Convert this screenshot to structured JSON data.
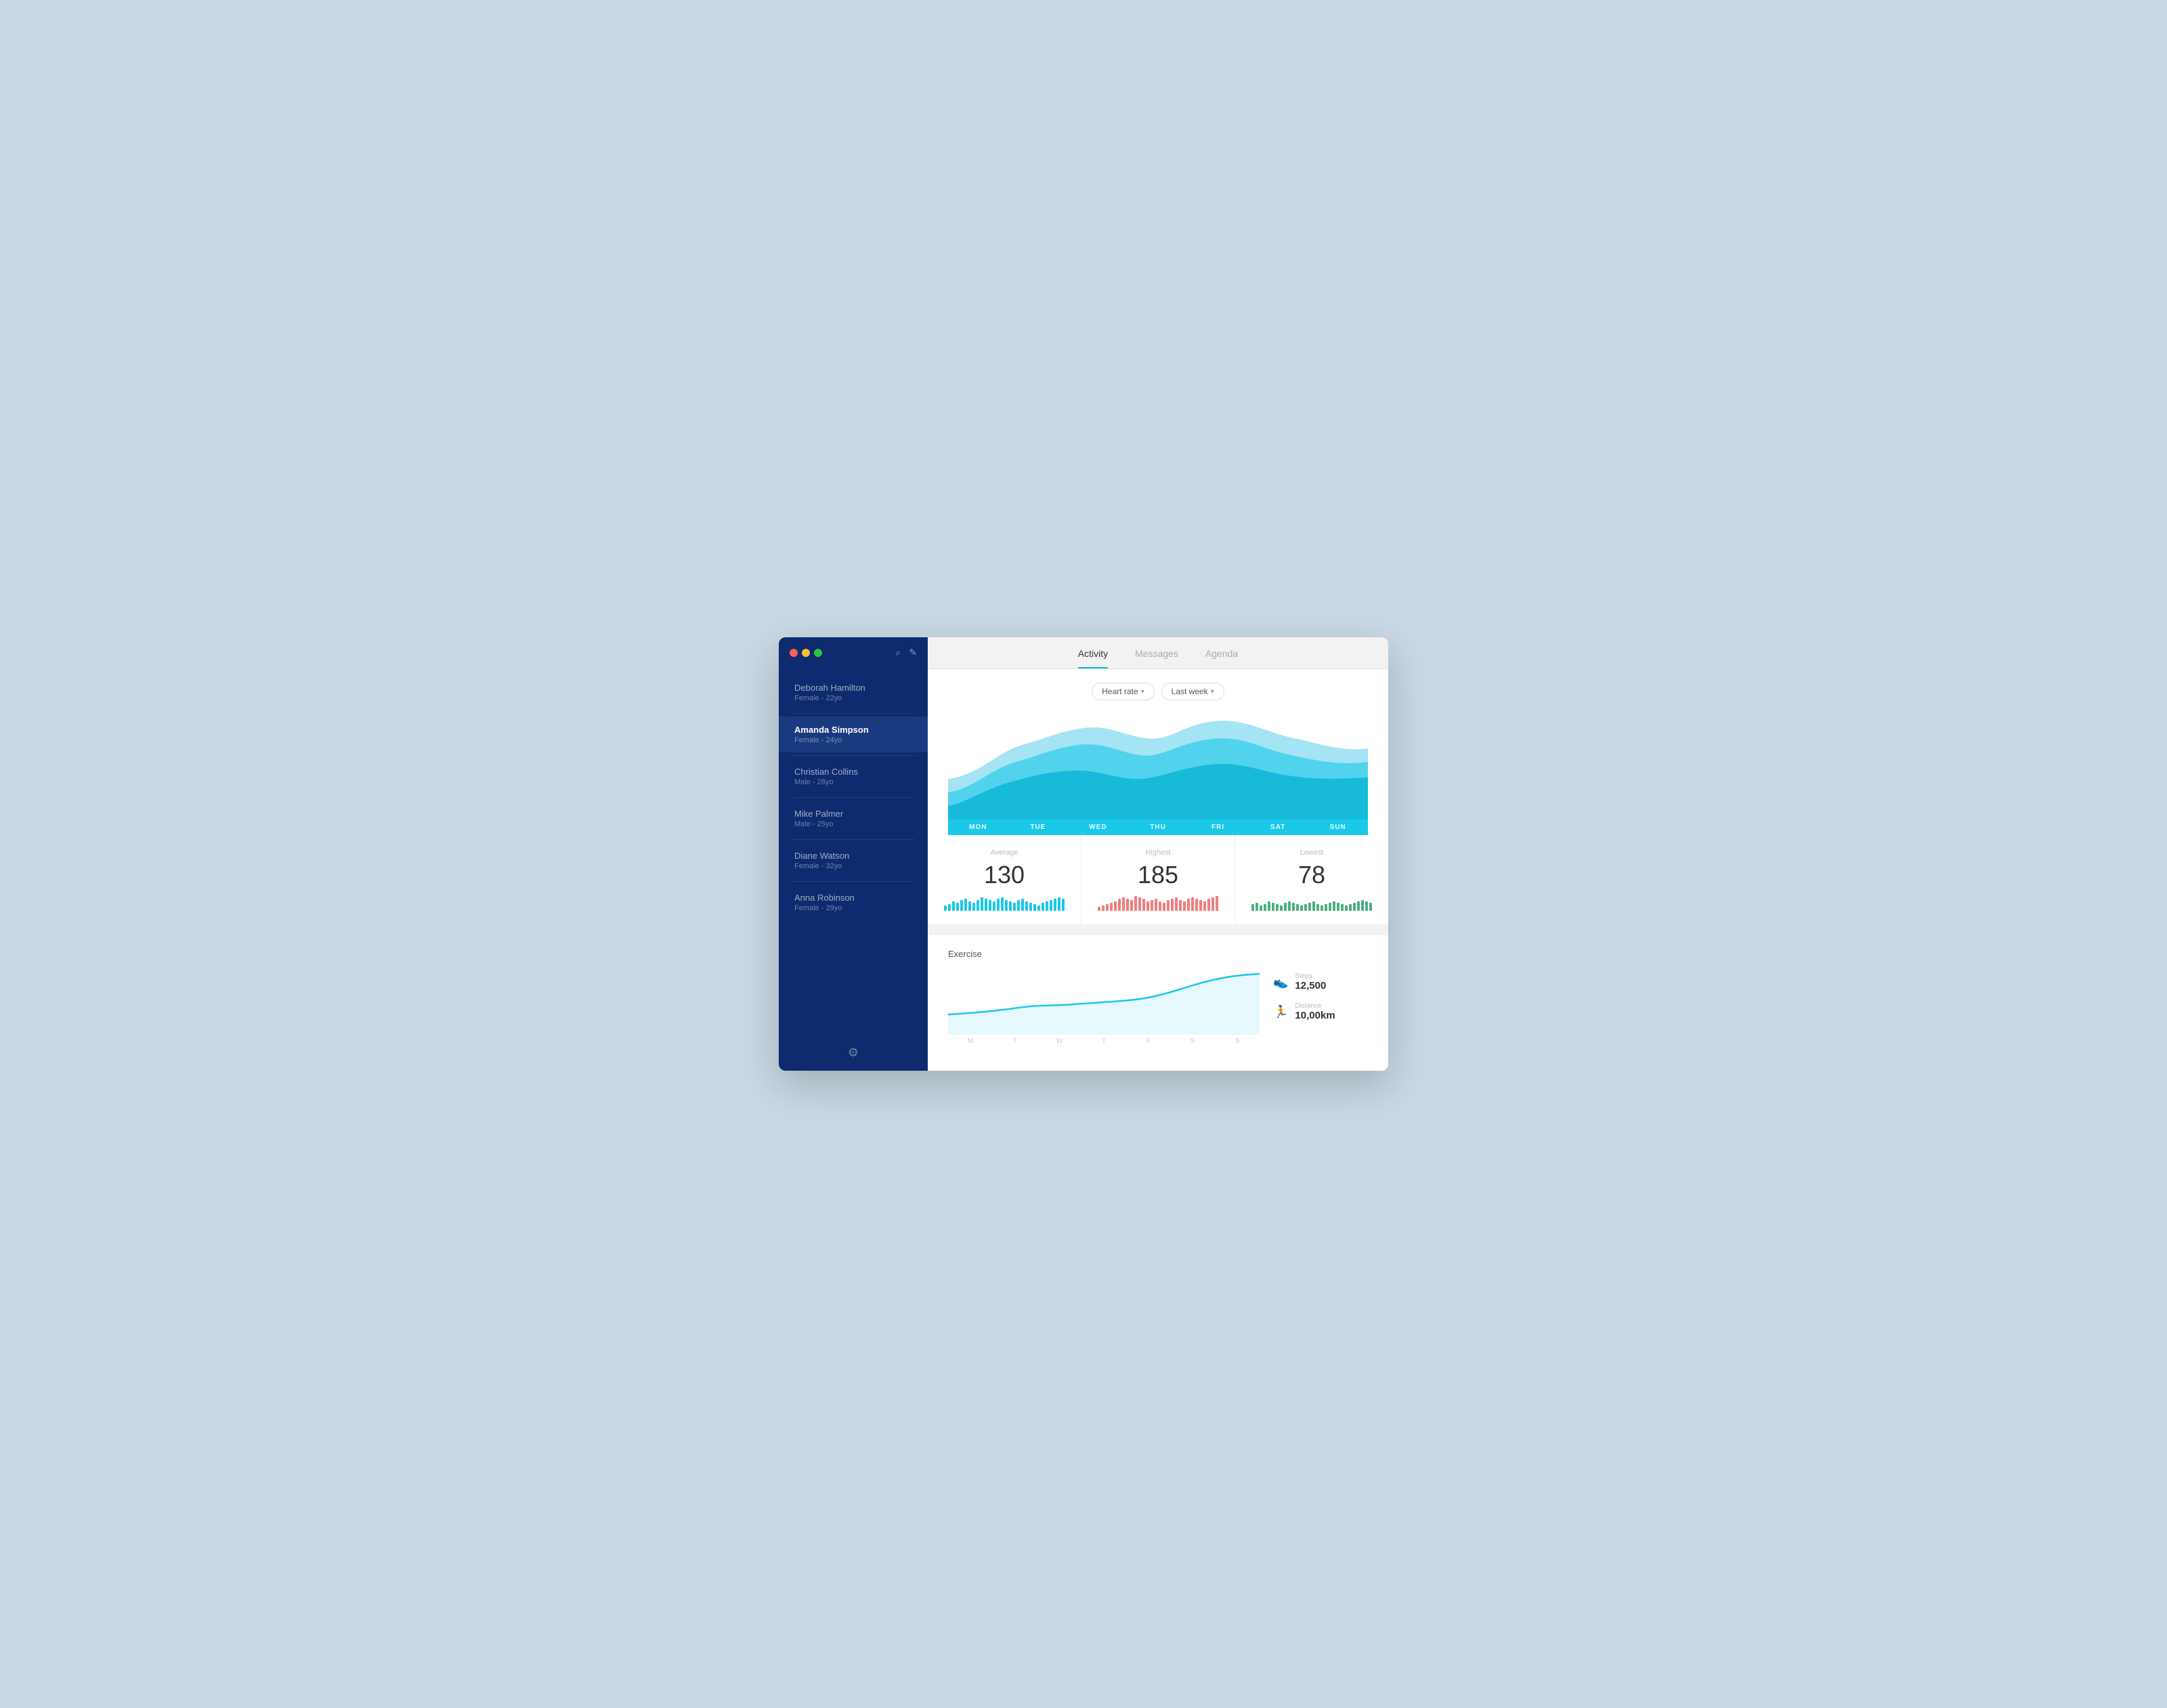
{
  "window": {
    "traffic_lights": [
      "red",
      "yellow",
      "green"
    ]
  },
  "sidebar": {
    "patients": [
      {
        "id": "deborah-hamilton",
        "name": "Deborah Hamilton",
        "meta": "Female - 22yo",
        "active": false
      },
      {
        "id": "amanda-simpson",
        "name": "Amanda Simpson",
        "meta": "Female - 24yo",
        "active": true
      },
      {
        "id": "christian-collins",
        "name": "Christian Collins",
        "meta": "Male - 28yo",
        "active": false
      },
      {
        "id": "mike-palmer",
        "name": "Mike Palmer",
        "meta": "Male - 25yo",
        "active": false
      },
      {
        "id": "diane-watson",
        "name": "Diane Watson",
        "meta": "Female - 32yo",
        "active": false
      },
      {
        "id": "anna-robinson",
        "name": "Anna Robinson",
        "meta": "Female - 29yo",
        "active": false
      }
    ]
  },
  "tabs": [
    {
      "id": "activity",
      "label": "Activity",
      "active": true
    },
    {
      "id": "messages",
      "label": "Messages",
      "active": false
    },
    {
      "id": "agenda",
      "label": "Agenda",
      "active": false
    }
  ],
  "filters": {
    "metric": "Heart rate",
    "period": "Last week"
  },
  "heart_rate_chart": {
    "days": [
      "MON",
      "TUE",
      "WED",
      "THU",
      "FRI",
      "SAT",
      "SUN"
    ]
  },
  "stats": {
    "average": {
      "label": "Average",
      "value": "130",
      "bar_color": "#1ac8e8"
    },
    "highest": {
      "label": "Highest",
      "value": "185",
      "bar_color": "#f47c7c"
    },
    "lowest": {
      "label": "Lowest",
      "value": "78",
      "bar_color": "#4caf82"
    }
  },
  "exercise": {
    "title": "Exercise",
    "days": [
      "M",
      "T",
      "W",
      "T",
      "F",
      "S",
      "S"
    ],
    "steps": {
      "label": "Steps",
      "value": "12,500"
    },
    "distance": {
      "label": "Distance",
      "value": "10,00km"
    }
  }
}
